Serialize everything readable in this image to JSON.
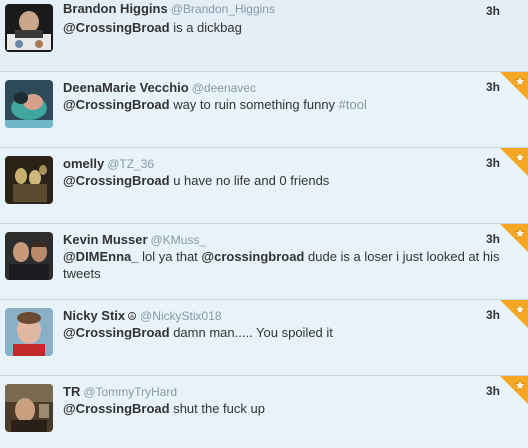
{
  "tweets": [
    {
      "name": "Brandon Higgins",
      "handle": "@Brandon_Higgins",
      "time": "3h",
      "mention": "@CrossingBroad",
      "text": " is a dickbag",
      "favorited": false
    },
    {
      "name": "DeenaMarie Vecchio",
      "handle": "@deenavec",
      "time": "3h",
      "mention": "@CrossingBroad",
      "text": " way to ruin something funny ",
      "hashtag": "#tool",
      "favorited": true
    },
    {
      "name": "omelly",
      "handle": "@TZ_36",
      "time": "3h",
      "mention": "@CrossingBroad",
      "text": " u have no life and 0 friends",
      "favorited": true
    },
    {
      "name": "Kevin Musser",
      "handle": "@KMuss_",
      "time": "3h",
      "mention": "@DIMEnna_",
      "text_a": " lol ya that ",
      "mention2": "@crossingbroad",
      "text_b": " dude is a loser i just looked at his tweets",
      "favorited": true
    },
    {
      "name": "Nicky Stix",
      "name_symbol": "☮",
      "handle": "@NickyStix018",
      "time": "3h",
      "mention": "@CrossingBroad",
      "text": " damn man..... You spoiled it",
      "favorited": true
    },
    {
      "name": "TR",
      "handle": "@TommyTryHard",
      "time": "3h",
      "mention": "@CrossingBroad",
      "text": " shut the fuck up",
      "favorited": true
    }
  ],
  "colors": {
    "background": "#e7f2f9",
    "favorite_star": "#f5a623",
    "handle": "#8899a6"
  },
  "icons": {
    "favorite": "star-icon"
  }
}
